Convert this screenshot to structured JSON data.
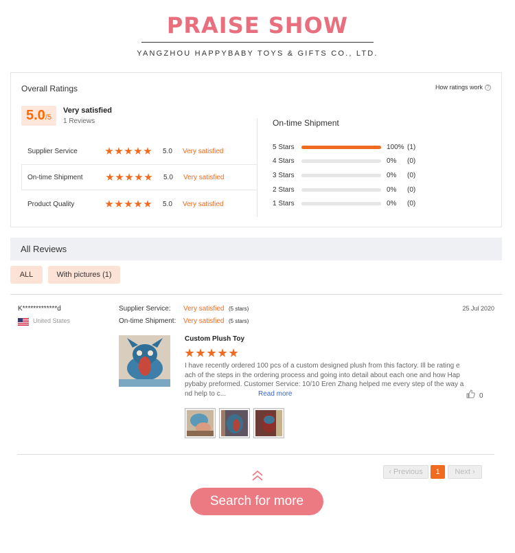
{
  "header": {
    "title": "PRAISE SHOW",
    "company": "YANGZHOU HAPPYBABY TOYS & GIFTS CO., LTD."
  },
  "overall": {
    "title": "Overall Ratings",
    "how_link": "How ratings work",
    "score": "5.0",
    "score_max": "/5",
    "summary": "Very satisfied",
    "reviews_count": "1 Reviews",
    "categories": [
      {
        "label": "Supplier Service",
        "stars": 5,
        "value": "5.0",
        "text": "Very satisfied"
      },
      {
        "label": "On-time Shipment",
        "stars": 5,
        "value": "5.0",
        "text": "Very satisfied"
      },
      {
        "label": "Product Quality",
        "stars": 5,
        "value": "5.0",
        "text": "Very satisfied"
      }
    ],
    "distribution_title": "On-time Shipment",
    "distribution": [
      {
        "label": "5 Stars",
        "fraction": 1.0,
        "percent": "100%",
        "count": "(1)"
      },
      {
        "label": "4 Stars",
        "fraction": 0,
        "percent": "0%",
        "count": "(0)"
      },
      {
        "label": "3 Stars",
        "fraction": 0,
        "percent": "0%",
        "count": "(0)"
      },
      {
        "label": "2 Stars",
        "fraction": 0,
        "percent": "0%",
        "count": "(0)"
      },
      {
        "label": "1 Stars",
        "fraction": 0,
        "percent": "0%",
        "count": "(0)"
      }
    ]
  },
  "reviews": {
    "title": "All Reviews",
    "filters": [
      "ALL",
      "With pictures (1)"
    ],
    "item": {
      "user": "K*************d",
      "country": "United States",
      "date": "25 Jul 2020",
      "supplier_label": "Supplier Service:",
      "supplier_value": "Very satisfied",
      "supplier_stars": "(5 stars)",
      "shipment_label": "On-time Shipment:",
      "shipment_value": "Very satisfied",
      "shipment_stars": "(5 stars)",
      "product_name": "Custom Plush Toy",
      "rating": 5,
      "text_lines": [
        "I have recently ordered 100 pcs of a custom designed plush from this factory. Ill be rating e",
        "ach of the steps in the ordering process and going into detail about each one and how Hap",
        "pybaby preformed. Customer Service: 10/10 Eren Zhang helped me every step of the way a",
        "nd help to c..."
      ],
      "read_more": "Read more",
      "likes": "0"
    }
  },
  "pagination": {
    "previous": "Previous",
    "current": "1",
    "next": "Next"
  },
  "cta": {
    "search": "Search for more"
  },
  "colors": {
    "accent": "#f06a1f",
    "title_pink": "#e86f7d",
    "button_pink": "#ec7a82"
  }
}
